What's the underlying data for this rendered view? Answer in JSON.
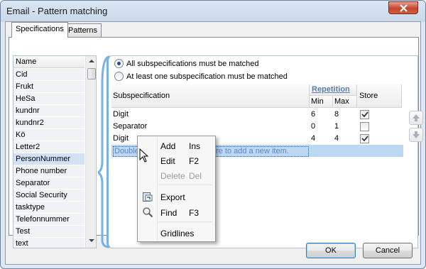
{
  "window": {
    "title": "Email - Pattern matching"
  },
  "tabs": [
    {
      "label": "Specifications",
      "active": true
    },
    {
      "label": "Patterns",
      "active": false
    }
  ],
  "pattern_list": {
    "header": "Name",
    "items": [
      "Cid",
      "Frukt",
      "HeSa",
      "kundnr",
      "kundnr2",
      "Kö",
      "Letter2",
      "PersonNummer",
      "Phone number",
      "Separator",
      "Social Security",
      "tasktype",
      "Telefonnummer",
      "Test",
      "text"
    ],
    "selected": "PersonNummer"
  },
  "match_mode": {
    "options": [
      "All subspecifications must be matched",
      "At least one subspecification must be matched"
    ],
    "selected_index": 0
  },
  "grid": {
    "headers": {
      "subspecification": "Subspecification",
      "repetition": "Repetition",
      "min": "Min",
      "max": "Max",
      "store": "Store"
    },
    "rows": [
      {
        "subspecification": "Digit",
        "min": "6",
        "max": "8",
        "store": true
      },
      {
        "subspecification": "Separator",
        "min": "0",
        "max": "1",
        "store": false
      },
      {
        "subspecification": "Digit",
        "min": "4",
        "max": "4",
        "store": true
      }
    ],
    "new_row_hint": "Double-click an empty cell here to add a new item."
  },
  "context_menu": {
    "items": [
      {
        "label": "Add",
        "shortcut": "Ins",
        "icon": "",
        "enabled": true
      },
      {
        "label": "Edit",
        "shortcut": "F2",
        "icon": "",
        "enabled": true
      },
      {
        "label": "Delete",
        "shortcut": "Del",
        "icon": "",
        "enabled": false
      },
      {
        "label": "Export",
        "shortcut": "",
        "icon": "export-icon",
        "enabled": true
      },
      {
        "label": "Find",
        "shortcut": "F3",
        "icon": "magnifier-icon",
        "enabled": true
      },
      {
        "label": "Gridlines",
        "shortcut": "",
        "icon": "",
        "enabled": true
      }
    ]
  },
  "footer": {
    "ok_label": "OK",
    "cancel_label": "Cancel"
  },
  "colors": {
    "selection": "#d2e1f5",
    "accent": "#79b0e6",
    "new_row": "#bdd8f3"
  }
}
